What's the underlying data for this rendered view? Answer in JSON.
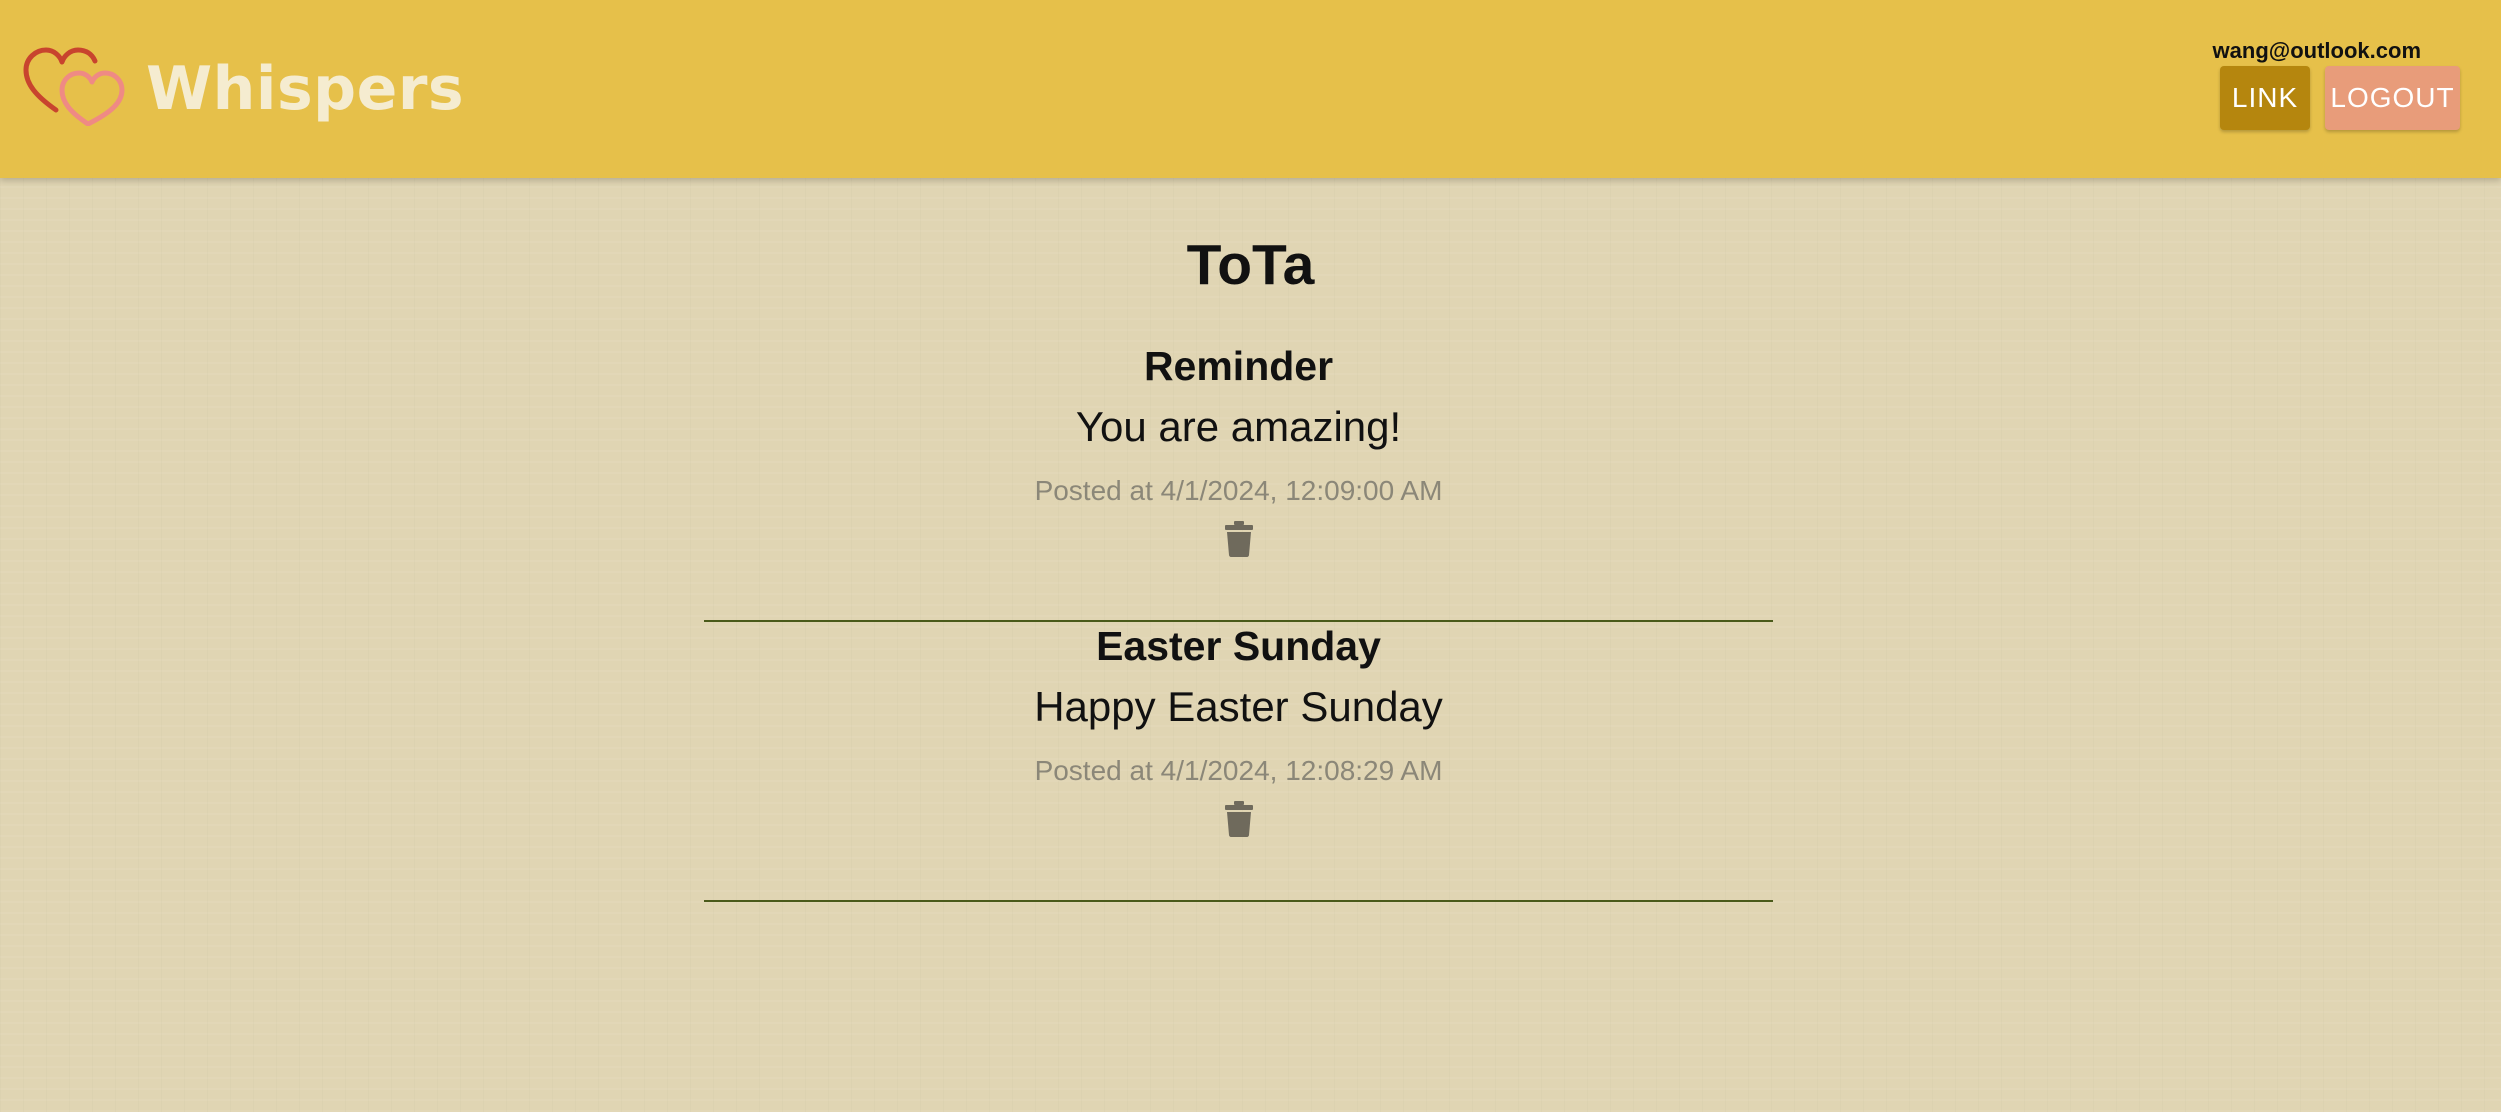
{
  "header": {
    "brand": "Whispers",
    "user_email": "wang@outlook.com",
    "link_label": "LINK",
    "logout_label": "LOGOUT"
  },
  "page": {
    "title": "ToTa"
  },
  "posts": [
    {
      "title": "Reminder",
      "body": "You are amazing!",
      "time": "Posted at 4/1/2024, 12:09:00 AM"
    },
    {
      "title": "Easter Sunday",
      "body": "Happy Easter Sunday",
      "time": "Posted at 4/1/2024, 12:08:29 AM"
    }
  ],
  "colors": {
    "header_bg": "#e6c04a",
    "page_bg": "#e0d5b3",
    "link_button": "#b5860e",
    "logout_button": "#e89c7a",
    "divider": "#4a5a1a",
    "timestamp": "#8b8778"
  },
  "icons": {
    "logo": "two-hearts-icon",
    "delete": "trash-icon"
  }
}
